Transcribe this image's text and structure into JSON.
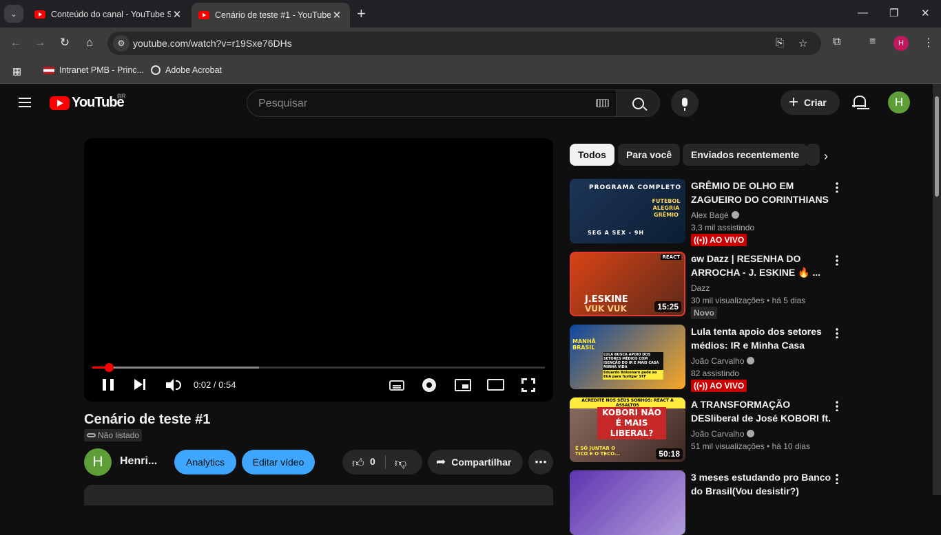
{
  "browser": {
    "tabs": [
      {
        "title": "Conteúdo do canal - YouTube S",
        "active": false
      },
      {
        "title": "Cenário de teste #1 - YouTube",
        "active": true
      }
    ],
    "url": "youtube.com/watch?v=r19Sxe76DHs",
    "bookmarks": [
      "Intranet PMB - Princ...",
      "Adobe Acrobat"
    ],
    "profile_initial": "H"
  },
  "youtube": {
    "logo_text": "YouTube",
    "country": "BR",
    "search_placeholder": "Pesquisar",
    "create_label": "Criar",
    "avatar_initial": "H"
  },
  "player": {
    "time": "0:02 / 0:54",
    "played_fraction": 0.037,
    "buffered_fraction": 0.368
  },
  "video": {
    "title": "Cenário de teste #1",
    "visibility": "Não listado",
    "channel_initial": "H",
    "channel_name": "Henri...",
    "analytics_label": "Analytics",
    "edit_label": "Editar vídeo",
    "like_count": "0",
    "share_label": "Compartilhar"
  },
  "chips": [
    "Todos",
    "Para você",
    "Enviados recentemente"
  ],
  "recommendations": [
    {
      "title": "GRÊMIO DE OLHO EM ZAGUEIRO DO CORINTHIANS |...",
      "channel": "Alex Bagé",
      "verified": true,
      "stats": "3,3 mil assistindo",
      "badge": "AO VIVO",
      "badge_type": "live",
      "thumb_text": [
        "PROGRAMA COMPLETO",
        "FUTEBOL ALEGRIA GRÊMIO",
        "SEG A SEX - 9H"
      ],
      "thumb_colors": [
        "#1d3557",
        "#0b1e33"
      ]
    },
    {
      "title": "ɢw Dazz | RESENHA DO ARROCHA - J. ESKINE 🔥 ...",
      "channel": "Dazz",
      "verified": false,
      "stats": "30 mil visualizações  • há 5 dias",
      "badge": "Novo",
      "badge_type": "new",
      "duration": "15:25",
      "thumb_text": [
        "REACT",
        "J.ESKINE",
        "VUK VUK"
      ],
      "thumb_colors": [
        "#d84315",
        "#5d2a1a"
      ]
    },
    {
      "title": "Lula tenta apoio dos setores médios: IR e Minha Casa Minh...",
      "channel": "João Carvalho",
      "verified": true,
      "stats": "82 assistindo",
      "badge": "AO VIVO",
      "badge_type": "live",
      "thumb_text": [
        "MANHÃ BRASIL",
        "LULA BUSCA APOIO DOS SETORES MÉDIOS COM ISENÇÃO DO IR E MAIS CASA MINHA VIDA",
        "Eduardo Bolsonaro pede ao EUA para fustigar STF"
      ],
      "thumb_colors": [
        "#0d47a1",
        "#f9a825"
      ]
    },
    {
      "title": "A TRANSFORMAÇÃO DESliberal de José KOBORI ft. Market...",
      "channel": "João Carvalho",
      "verified": true,
      "stats": "51 mil visualizações  • há 10 dias",
      "duration": "50:18",
      "thumb_text": [
        "ACREDITE NOS SEUS SONHOS: REACT A ASSALTOS",
        "KOBORI NÃO É MAIS LIBERAL?",
        "É SÓ JUNTAR O TICO E O TECO..."
      ],
      "thumb_colors": [
        "#8d6e63",
        "#3e2723"
      ]
    },
    {
      "title": "3 meses estudando pro Banco do Brasil(Vou desistir?)",
      "channel": "",
      "verified": false,
      "stats": "",
      "thumb_text": [],
      "thumb_colors": [
        "#5e35b1",
        "#b39ddb"
      ]
    }
  ]
}
